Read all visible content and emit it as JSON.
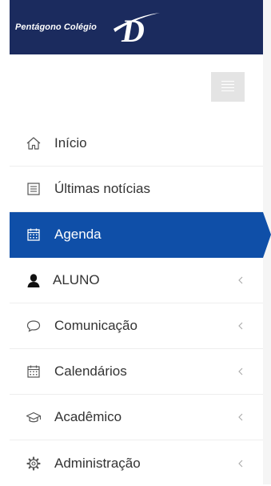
{
  "header": {
    "brand_text": "Pentágono Colégio",
    "logo_letter": "D",
    "colors": {
      "navy": "#1b2b5e",
      "active": "#0f4fa8"
    }
  },
  "menu_toggle": {
    "icon": "hamburger-icon"
  },
  "menu": {
    "items": [
      {
        "label": "Início",
        "icon": "home-icon",
        "has_chevron": false,
        "active": false
      },
      {
        "label": "Últimas notícias",
        "icon": "news-icon",
        "has_chevron": false,
        "active": false
      },
      {
        "label": "Agenda",
        "icon": "calendar-icon",
        "has_chevron": false,
        "active": true
      },
      {
        "label": "ALUNO",
        "icon": "user-icon",
        "has_chevron": true,
        "active": false
      },
      {
        "label": "Comunicação",
        "icon": "chat-icon",
        "has_chevron": true,
        "active": false
      },
      {
        "label": "Calendários",
        "icon": "calendar-icon",
        "has_chevron": true,
        "active": false
      },
      {
        "label": "Acadêmico",
        "icon": "graduation-cap-icon",
        "has_chevron": true,
        "active": false
      },
      {
        "label": "Administração",
        "icon": "gear-icon",
        "has_chevron": true,
        "active": false
      }
    ]
  }
}
